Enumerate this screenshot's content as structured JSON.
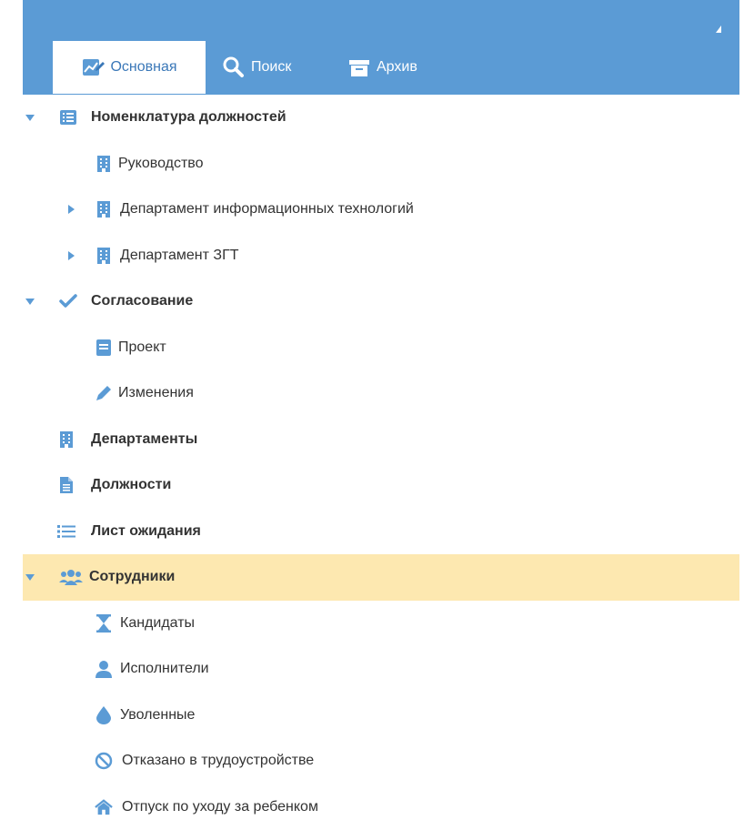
{
  "tabs": [
    {
      "label": "Основная",
      "icon": "chart-edit-icon",
      "active": true
    },
    {
      "label": "Поиск",
      "icon": "search-icon",
      "active": false
    },
    {
      "label": "Архив",
      "icon": "archive-box-icon",
      "active": false
    }
  ],
  "tree": {
    "nomenclature": {
      "label": "Номенклатура должностей",
      "icon": "list-icon",
      "expanded": true
    },
    "management": {
      "label": "Руководство",
      "icon": "building-icon"
    },
    "dept_it": {
      "label": "Департамент информационных технологий",
      "icon": "building-icon",
      "expanded": false
    },
    "dept_zgt": {
      "label": "Департамент ЗГТ",
      "icon": "building-icon",
      "expanded": false
    },
    "approval": {
      "label": "Согласование",
      "icon": "check-icon",
      "expanded": true
    },
    "project": {
      "label": "Проект",
      "icon": "book-icon"
    },
    "changes": {
      "label": "Изменения",
      "icon": "pencil-icon"
    },
    "departments": {
      "label": "Департаменты",
      "icon": "building-icon"
    },
    "positions": {
      "label": "Должности",
      "icon": "document-icon"
    },
    "waitlist": {
      "label": "Лист ожидания",
      "icon": "bullet-list-icon"
    },
    "employees": {
      "label": "Сотрудники",
      "icon": "users-icon",
      "expanded": true,
      "selected": true
    },
    "candidates": {
      "label": "Кандидаты",
      "icon": "hourglass-icon"
    },
    "performers": {
      "label": "Исполнители",
      "icon": "user-icon"
    },
    "dismissed": {
      "label": "Уволенные",
      "icon": "drop-icon"
    },
    "rejected": {
      "label": "Отказано в трудоустройстве",
      "icon": "ban-icon"
    },
    "parental_leave": {
      "label": "Отпуск по уходу за ребенком",
      "icon": "home-icon"
    }
  },
  "colors": {
    "accent": "#5b9bd5",
    "selected_row": "#fde8b0",
    "icon_blue": "#5b9bd5",
    "text": "#333333"
  }
}
